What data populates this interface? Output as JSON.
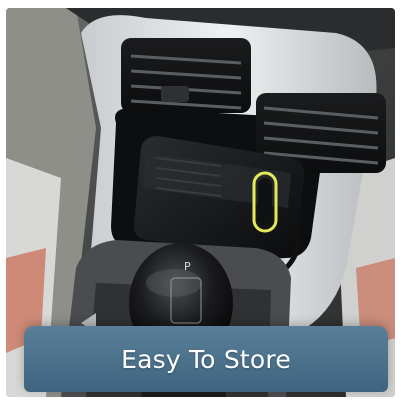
{
  "product_card": {
    "caption": "Easy To Store",
    "colors": {
      "caption_bg": "#4d7290",
      "caption_text": "#ffffff",
      "accent_led": "#e5e85a"
    }
  }
}
